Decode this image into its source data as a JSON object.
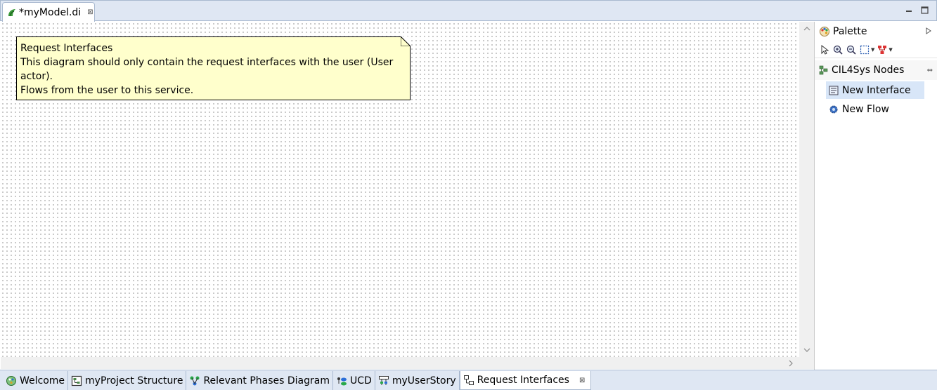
{
  "editor_tab": {
    "title": "*myModel.di",
    "close": "⊠"
  },
  "window": {
    "minimize": "▬",
    "maximize": "▢"
  },
  "note": {
    "title": "Request Interfaces",
    "line1": "This diagram should only contain the request interfaces with the user (User actor).",
    "line2": "Flows from the user to this service."
  },
  "palette": {
    "title": "Palette",
    "drawer": "CIL4Sys Nodes",
    "entries": [
      {
        "label": "New Interface",
        "icon": "interface-icon",
        "selected": true
      },
      {
        "label": "New Flow",
        "icon": "gear-icon",
        "selected": false
      }
    ]
  },
  "bottom_tabs": [
    {
      "label": "Welcome",
      "icon": "welcome-icon"
    },
    {
      "label": "myProject Structure",
      "icon": "structure-icon"
    },
    {
      "label": "Relevant Phases Diagram",
      "icon": "phases-icon"
    },
    {
      "label": "UCD",
      "icon": "ucd-icon"
    },
    {
      "label": "myUserStory",
      "icon": "userstory-icon"
    },
    {
      "label": "Request Interfaces",
      "icon": "interfaces-diagram-icon",
      "active": true
    }
  ],
  "colors": {
    "note_bg": "#ffffcc",
    "tab_bar": "#dfe7f3",
    "selection": "#d8e6f8"
  }
}
